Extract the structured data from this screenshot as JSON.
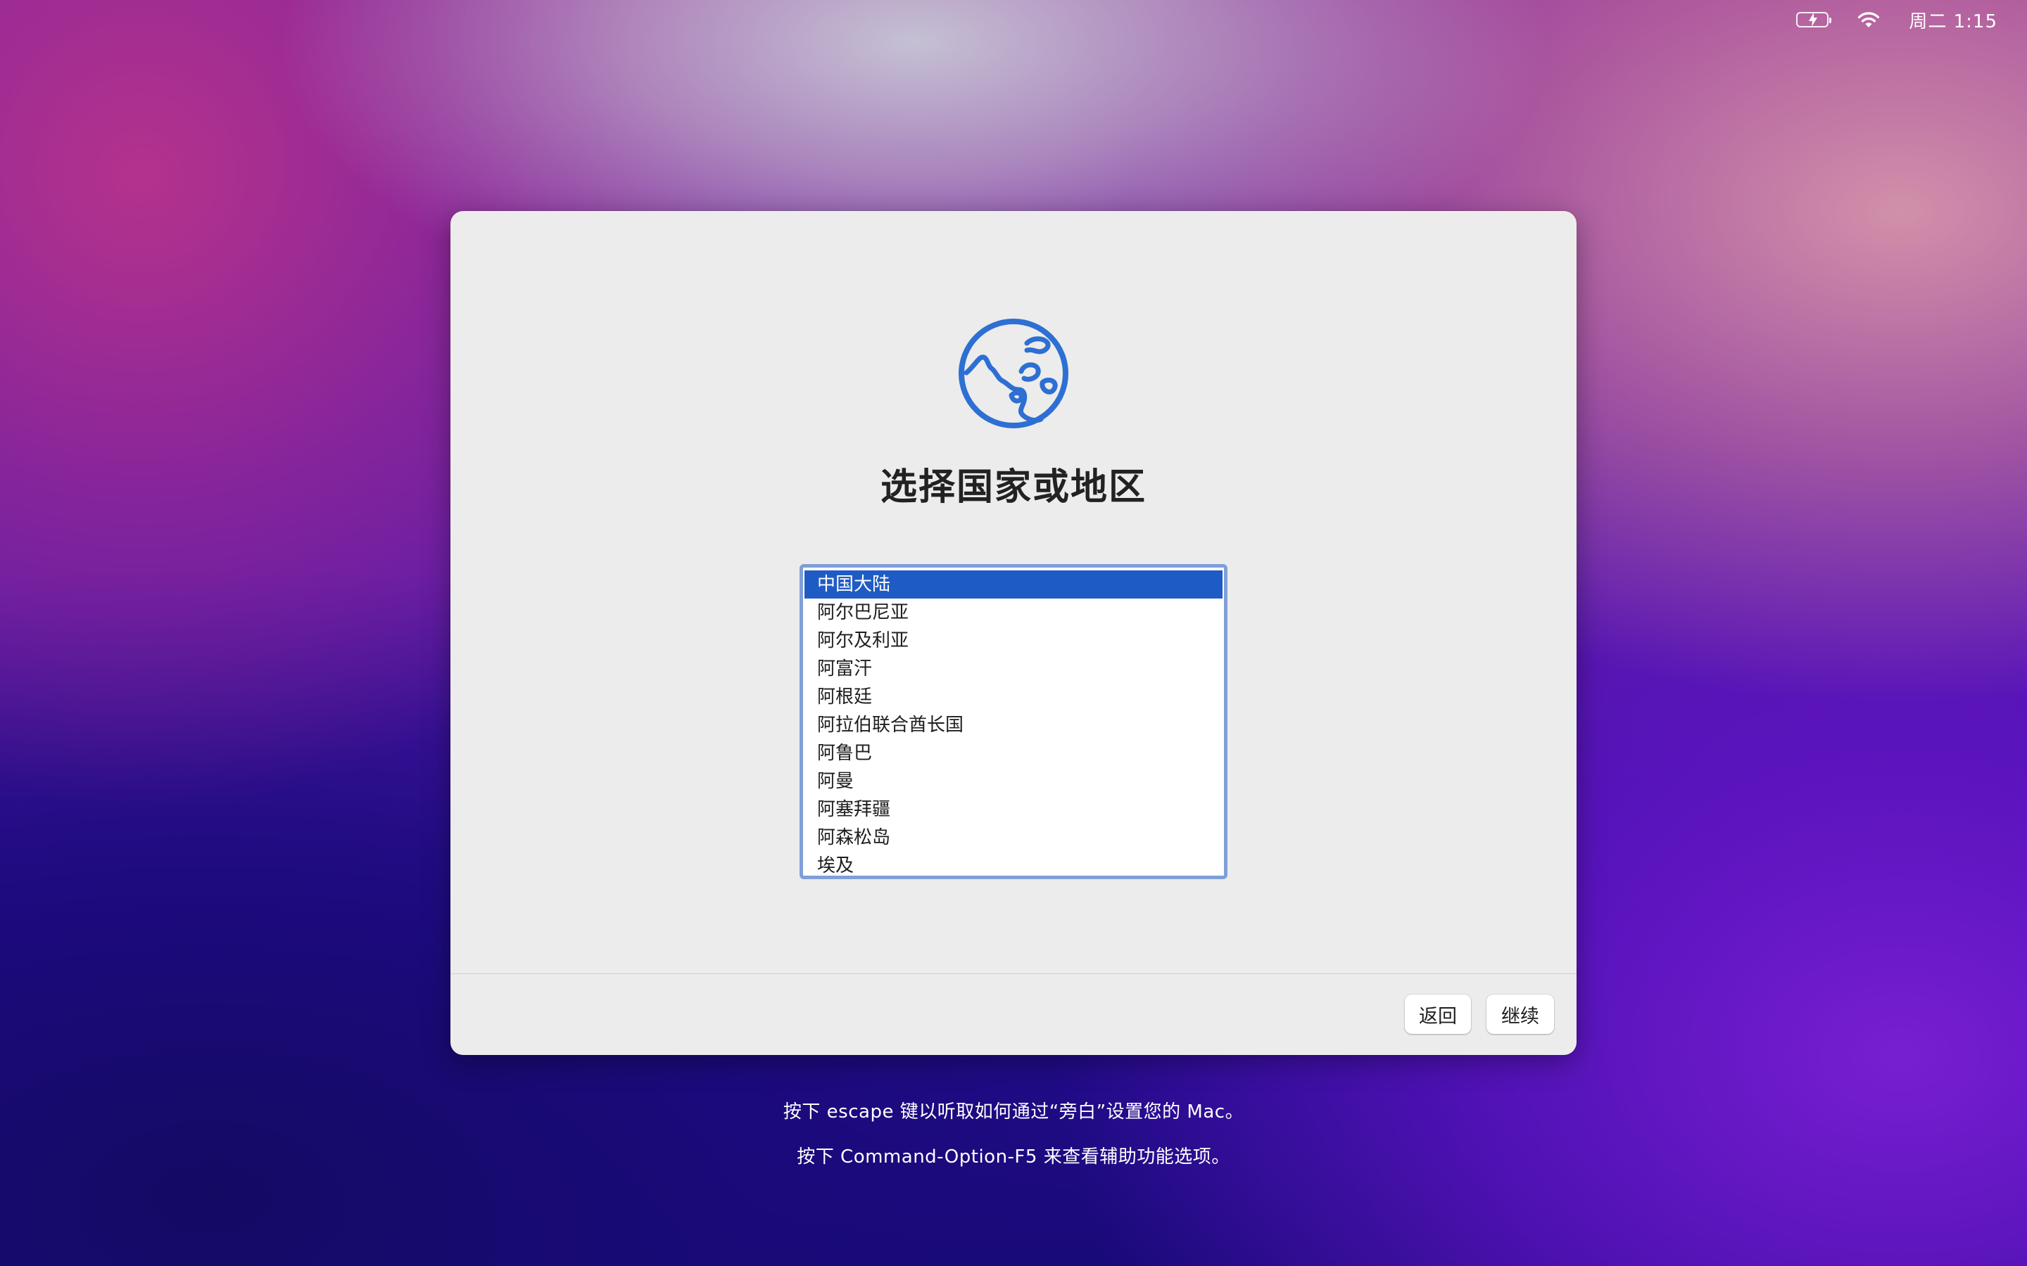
{
  "menubar": {
    "battery_icon": "battery-charging-icon",
    "wifi_icon": "wifi-icon",
    "clock": "周二 1:15"
  },
  "dialog": {
    "icon": "globe-icon",
    "icon_color": "#2d6fd2",
    "title": "选择国家或地区",
    "list": {
      "selected": "中国大陆",
      "items": [
        "中国大陆",
        "阿尔巴尼亚",
        "阿尔及利亚",
        "阿富汗",
        "阿根廷",
        "阿拉伯联合酋长国",
        "阿鲁巴",
        "阿曼",
        "阿塞拜疆",
        "阿森松岛",
        "埃及"
      ]
    },
    "buttons": {
      "back": "返回",
      "continue": "继续"
    }
  },
  "hints": {
    "voiceover": "按下 escape 键以听取如何通过“旁白”设置您的 Mac。",
    "accessibility": "按下 Command-Option-F5 来查看辅助功能选项。"
  },
  "colors": {
    "selection": "#1f5bc4",
    "list_focus_ring": "#7f9fd8"
  }
}
